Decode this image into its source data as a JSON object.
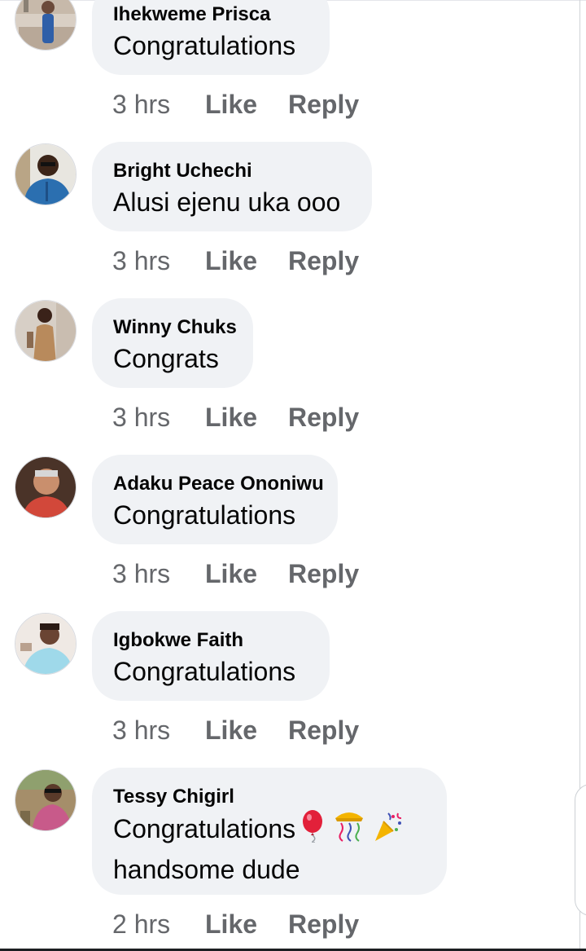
{
  "comments": [
    {
      "author": "Ihekweme Prisca",
      "text": "Congratulations",
      "time": "3 hrs",
      "like": "Like",
      "reply": "Reply"
    },
    {
      "author": "Bright Uchechi",
      "text": "Alusi ejenu uka ooo",
      "time": "3 hrs",
      "like": "Like",
      "reply": "Reply"
    },
    {
      "author": "Winny Chuks",
      "text": "Congrats",
      "time": "3 hrs",
      "like": "Like",
      "reply": "Reply"
    },
    {
      "author": "Adaku Peace Ononiwu",
      "text": "Congratulations",
      "time": "3 hrs",
      "like": "Like",
      "reply": "Reply"
    },
    {
      "author": "Igbokwe Faith",
      "text": "Congratulations",
      "time": "3 hrs",
      "like": "Like",
      "reply": "Reply"
    },
    {
      "author": "Tessy Chigirl",
      "text_line1": "Congratulations",
      "text_line2": "handsome dude",
      "emojis": [
        "balloon-icon",
        "confetti-ball-icon",
        "party-popper-icon"
      ],
      "time": "2 hrs",
      "like": "Like",
      "reply": "Reply"
    }
  ],
  "colors": {
    "bubble": "#f0f2f5",
    "meta_text": "#65676b",
    "name_text": "#050505"
  }
}
